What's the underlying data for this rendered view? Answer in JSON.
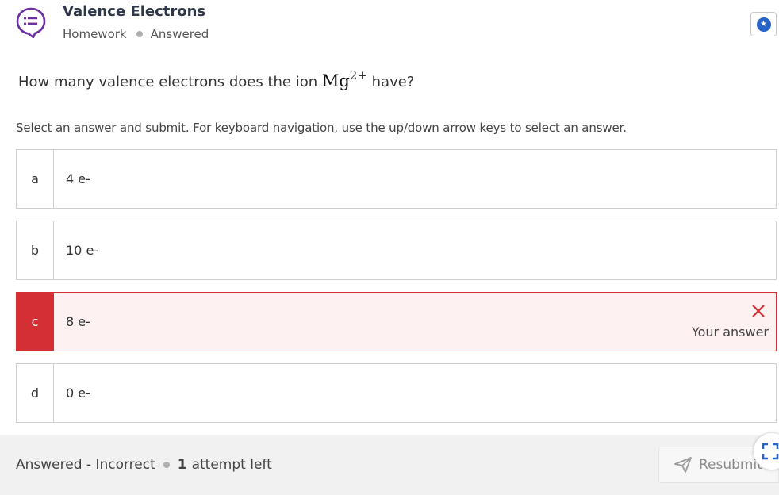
{
  "header": {
    "title": "Valence Electrons",
    "type_label": "Homework",
    "state_label": "Answered",
    "logo_icon": "chat-list-icon",
    "star_icon": "star-icon"
  },
  "question": {
    "prefix": "How many valence electrons does the ion ",
    "ion_symbol": "Mg",
    "ion_charge": "2+",
    "suffix": " have?"
  },
  "instructions": "Select an answer and submit. For keyboard navigation, use the up/down arrow keys to select an answer.",
  "options": [
    {
      "letter": "a",
      "text": "4 e-"
    },
    {
      "letter": "b",
      "text": "10 e-"
    },
    {
      "letter": "c",
      "text": "8 e-",
      "selected": true,
      "status_label": "Your answer"
    },
    {
      "letter": "d",
      "text": "0 e-"
    }
  ],
  "footer": {
    "result": "Answered - Incorrect",
    "attempts_count": "1",
    "attempts_label": "attempt left",
    "resubmit_label": "Resubmit",
    "resubmit_icon": "send-icon",
    "expand_icon": "expand-icon"
  },
  "colors": {
    "accent_purple": "#6b2fa0",
    "incorrect_red": "#d32f35",
    "star_blue": "#2563c9"
  }
}
